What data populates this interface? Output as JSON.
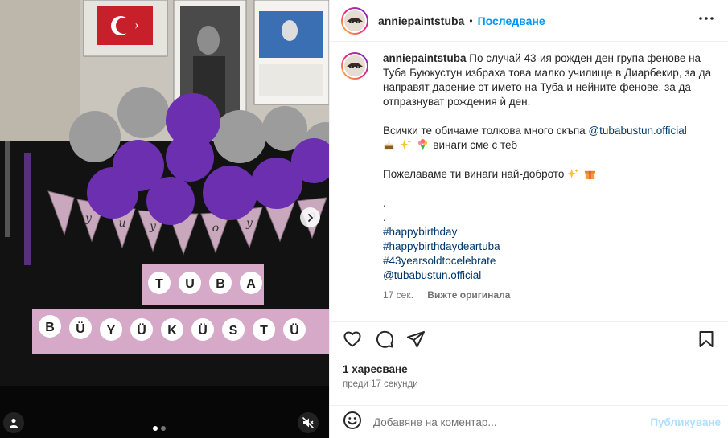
{
  "post": {
    "username": "anniepaintstuba",
    "follow_label": "Последване",
    "separator": "•"
  },
  "caption": {
    "username": "anniepaintstuba",
    "paragraph1": "По случай 43-ия рожден ден група фенове на Туба Буюкустун избраха това малко училище в Диарбекир, за да направят дарение от името на Туба и нейните фенове, за да отпразнуват рождения ѝ ден.",
    "paragraph2_text": "Всички те обичаме толкова много скъпа",
    "paragraph2_mention": "@tubabustun.official",
    "paragraph2_tail": "винаги сме с теб",
    "paragraph3": "Пожелаваме ти винаги най-доброто",
    "dot1": ".",
    "dot2": ".",
    "hashtags": [
      "#happybirthday",
      "#happybirthdaydeartuba",
      "#43yearsoldtocelebrate",
      "@tubabustun.official"
    ],
    "time_ago": "17 сек.",
    "see_translation": "Вижте оригинала"
  },
  "likes": "1 харесване",
  "posted_when": "преди 17 секунди",
  "comment": {
    "placeholder": "Добавяне на коментар...",
    "publish_label": "Публикуване"
  },
  "media": {
    "banner_letters": [
      "T",
      "U",
      "B",
      "A"
    ],
    "banner_letters2": [
      "B",
      "Ü",
      "Y",
      "Ü",
      "K",
      "Ü",
      "S",
      "T",
      "Ü"
    ],
    "garland_letters": [
      "y",
      "u",
      "y",
      "o",
      "y",
      "o"
    ],
    "carousel_dots": 2,
    "active_dot": 0
  },
  "colors": {
    "accent": "#0095f6",
    "link": "#00376b",
    "balloon_purple": "#6b2fb0",
    "balloon_gray": "#9a9a9a",
    "banner_pink": "#d7a9c8"
  }
}
